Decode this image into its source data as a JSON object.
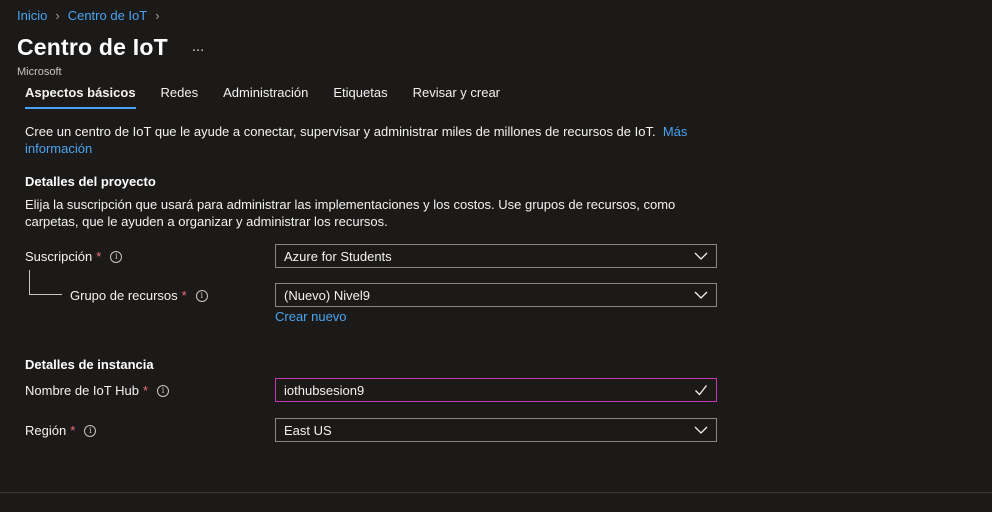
{
  "breadcrumb": {
    "items": [
      "Inicio",
      "Centro de IoT"
    ]
  },
  "header": {
    "title": "Centro de IoT",
    "more": "...",
    "subtitle": "Microsoft"
  },
  "tabs": [
    {
      "label": "Aspectos básicos",
      "active": true
    },
    {
      "label": "Redes",
      "active": false
    },
    {
      "label": "Administración",
      "active": false
    },
    {
      "label": "Etiquetas",
      "active": false
    },
    {
      "label": "Revisar y crear",
      "active": false
    }
  ],
  "intro": {
    "text": "Cree un centro de IoT que le ayude a conectar, supervisar y administrar miles de millones de recursos de IoT.",
    "link": "Más información"
  },
  "project": {
    "title": "Detalles del proyecto",
    "description": "Elija la suscripción que usará para administrar las implementaciones y los costos. Use grupos de recursos, como carpetas, que le ayuden a organizar y administrar los recursos.",
    "subscription": {
      "label": "Suscripción",
      "required": "*",
      "value": "Azure for Students"
    },
    "resource_group": {
      "label": "Grupo de recursos",
      "required": "*",
      "value": "(Nuevo) Nivel9",
      "create_link": "Crear nuevo"
    }
  },
  "instance": {
    "title": "Detalles de instancia",
    "hub_name": {
      "label": "Nombre de IoT Hub",
      "required": "*",
      "value": "iothubsesion9"
    },
    "region": {
      "label": "Región",
      "required": "*",
      "value": "East US"
    }
  },
  "colors": {
    "background": "#1b1a19",
    "link": "#4aa3f0",
    "required": "#f1707b",
    "validated_border": "#c239b3"
  }
}
